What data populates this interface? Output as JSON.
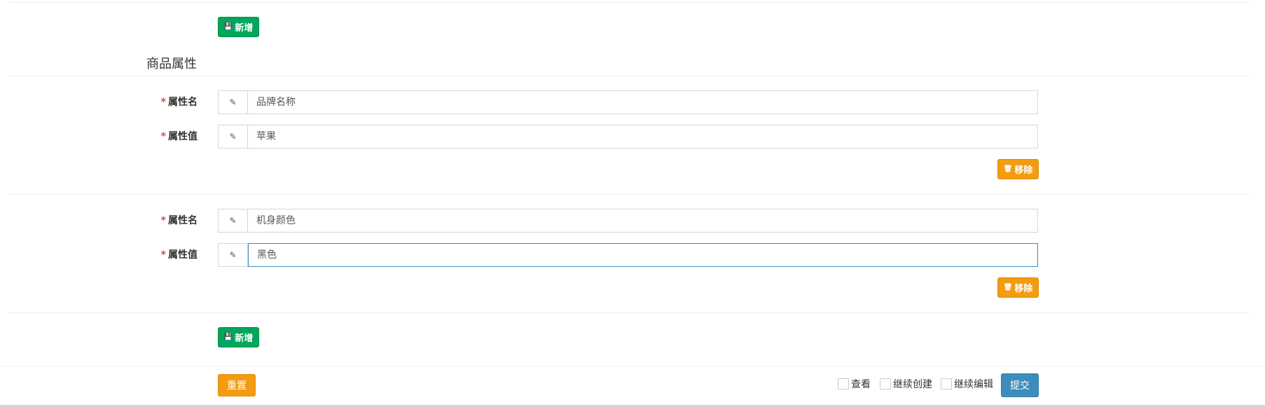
{
  "buttons": {
    "add_top": "新增",
    "add_bottom": "新增",
    "remove_1": "移除",
    "remove_2": "移除",
    "reset": "重置",
    "submit": "提交"
  },
  "section": {
    "title": "商品属性"
  },
  "attributes": [
    {
      "name_label": "属性名",
      "name_value": "品牌名称",
      "value_label": "属性值",
      "value_value": "苹果"
    },
    {
      "name_label": "属性名",
      "name_value": "机身颜色",
      "value_label": "属性值",
      "value_value": "黑色"
    }
  ],
  "required_mark": "*",
  "footer": {
    "check_view": "查看",
    "check_continue_create": "继续创建",
    "check_continue_edit": "继续编辑"
  },
  "icons": {
    "save": "save-icon",
    "pencil": "pencil-icon",
    "trash": "trash-icon"
  },
  "colors": {
    "green": "#00a65a",
    "orange": "#f39c12",
    "blue": "#3c8dbc",
    "required": "#dd4b39"
  }
}
